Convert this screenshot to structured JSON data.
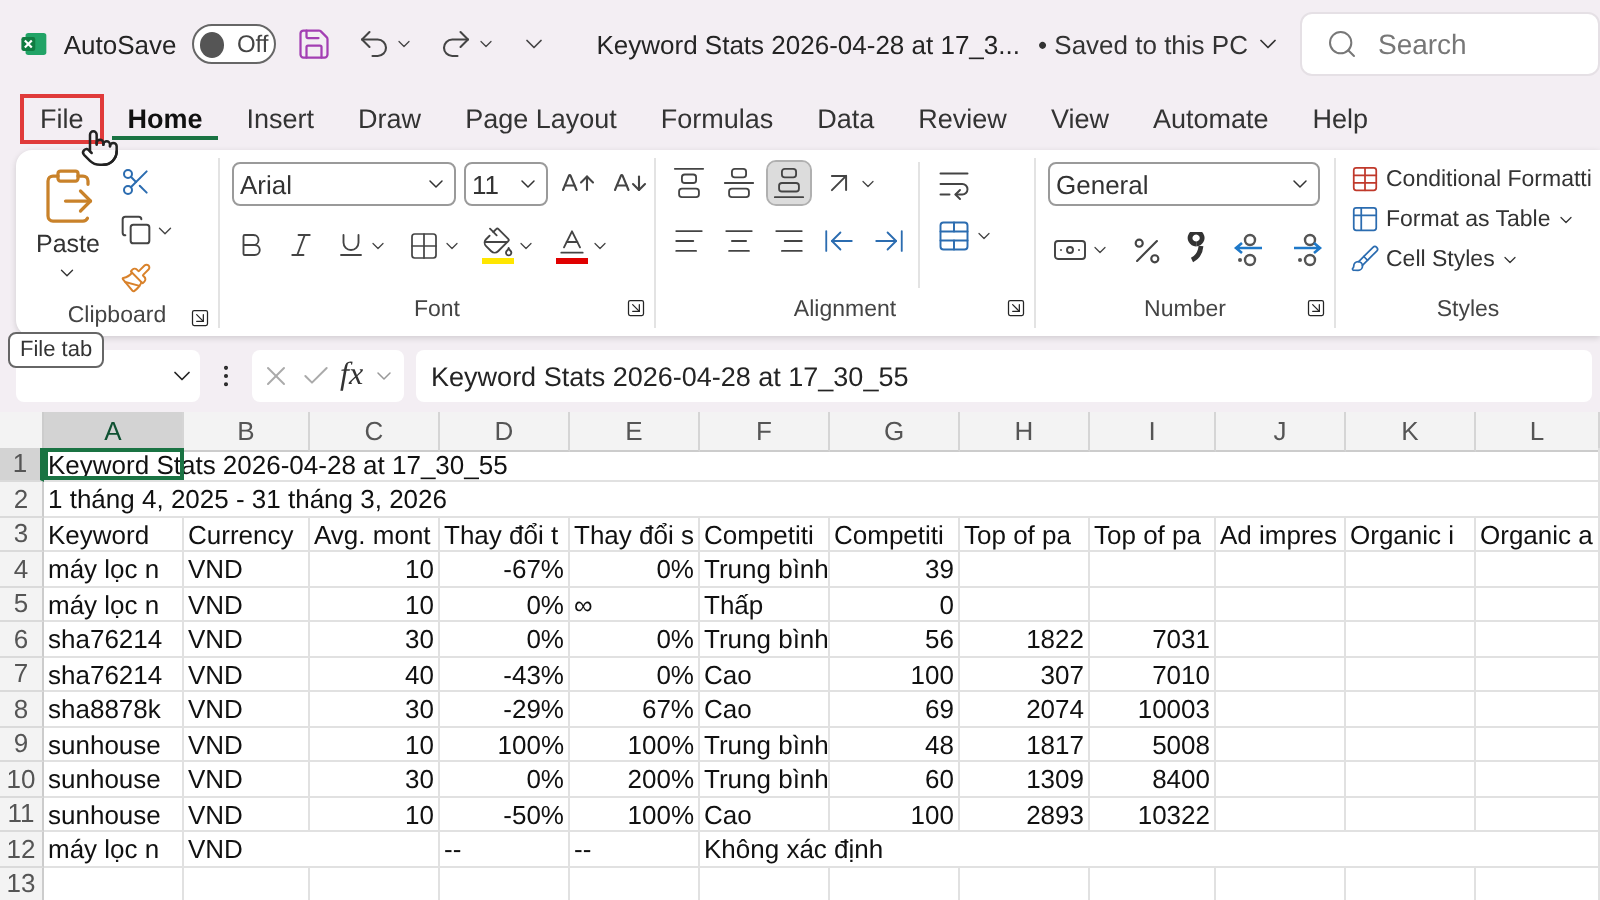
{
  "title_bar": {
    "autosave_label": "AutoSave",
    "autosave": {
      "on": false,
      "label": "Off"
    },
    "title": "Keyword Stats 2026-04-28 at 17_3...",
    "save_status": "• Saved to this PC",
    "search": {
      "placeholder": "Search"
    }
  },
  "tabs": [
    {
      "label": "File",
      "selected": false,
      "highlighted": true
    },
    {
      "label": "Home",
      "selected": true,
      "highlighted": false
    },
    {
      "label": "Insert",
      "selected": false,
      "highlighted": false
    },
    {
      "label": "Draw",
      "selected": false,
      "highlighted": false
    },
    {
      "label": "Page Layout",
      "selected": false,
      "highlighted": false
    },
    {
      "label": "Formulas",
      "selected": false,
      "highlighted": false
    },
    {
      "label": "Data",
      "selected": false,
      "highlighted": false
    },
    {
      "label": "Review",
      "selected": false,
      "highlighted": false
    },
    {
      "label": "View",
      "selected": false,
      "highlighted": false
    },
    {
      "label": "Automate",
      "selected": false,
      "highlighted": false
    },
    {
      "label": "Help",
      "selected": false,
      "highlighted": false
    }
  ],
  "ribbon": {
    "clipboard": {
      "label": "Clipboard",
      "paste": "Paste"
    },
    "font": {
      "label": "Font",
      "font_name": "Arial",
      "font_size": "11"
    },
    "alignment": {
      "label": "Alignment",
      "vertical_buttons": [
        {
          "kind": "top",
          "selected": false
        },
        {
          "kind": "middle",
          "selected": false
        },
        {
          "kind": "bottom",
          "selected": true
        }
      ]
    },
    "number": {
      "label": "Number",
      "format": "General"
    },
    "styles": {
      "label": "Styles",
      "buttons": [
        "Conditional Formatti",
        "Format as Table",
        "Cell Styles"
      ]
    }
  },
  "tooltip": "File tab",
  "formula_bar": {
    "fx": "fx",
    "formula": "Keyword Stats 2026-04-28 at 17_30_55"
  },
  "sheet": {
    "columns": [
      {
        "label": "A",
        "selected": true
      },
      {
        "label": "B",
        "selected": false
      },
      {
        "label": "C",
        "selected": false
      },
      {
        "label": "D",
        "selected": false
      },
      {
        "label": "E",
        "selected": false
      },
      {
        "label": "F",
        "selected": false
      },
      {
        "label": "G",
        "selected": false
      },
      {
        "label": "H",
        "selected": false
      },
      {
        "label": "I",
        "selected": false
      },
      {
        "label": "J",
        "selected": false
      },
      {
        "label": "K",
        "selected": false
      },
      {
        "label": "L",
        "selected": false
      }
    ],
    "rows": [
      {
        "number": "1",
        "selected": true,
        "cells": [
          {
            "text": "Keyword Stats 2026-04-28 at 17_30_55",
            "kind": "text",
            "selected": true
          },
          null,
          null,
          null,
          null,
          null,
          null,
          null,
          null,
          null,
          null,
          null
        ]
      },
      {
        "number": "2",
        "selected": false,
        "cells": [
          {
            "text": "1 tháng 4, 2025 - 31 tháng 3, 2026",
            "kind": "text",
            "selected": false
          },
          null,
          null,
          null,
          null,
          null,
          null,
          null,
          null,
          null,
          null,
          null
        ]
      },
      {
        "number": "3",
        "selected": false,
        "cells": [
          {
            "text": "Keyword",
            "kind": "text",
            "selected": false
          },
          {
            "text": "Currency",
            "kind": "text",
            "selected": false
          },
          {
            "text": "Avg. mont",
            "kind": "text",
            "selected": false
          },
          {
            "text": "Thay đổi t",
            "kind": "text",
            "selected": false
          },
          {
            "text": "Thay đổi s",
            "kind": "text",
            "selected": false
          },
          {
            "text": "Competiti",
            "kind": "text",
            "selected": false
          },
          {
            "text": "Competiti",
            "kind": "text",
            "selected": false
          },
          {
            "text": "Top of pa",
            "kind": "text",
            "selected": false
          },
          {
            "text": "Top of pa",
            "kind": "text",
            "selected": false
          },
          {
            "text": "Ad impres",
            "kind": "text",
            "selected": false
          },
          {
            "text": "Organic i",
            "kind": "text",
            "selected": false
          },
          {
            "text": "Organic a",
            "kind": "text",
            "selected": false
          }
        ]
      },
      {
        "number": "4",
        "selected": false,
        "cells": [
          {
            "text": "máy lọc n",
            "kind": "text",
            "selected": false
          },
          {
            "text": "VND",
            "kind": "text",
            "selected": false
          },
          {
            "text": "10",
            "kind": "number",
            "selected": false
          },
          {
            "text": "-67%",
            "kind": "number",
            "selected": false
          },
          {
            "text": "0%",
            "kind": "number",
            "selected": false
          },
          {
            "text": "Trung bình",
            "kind": "text",
            "selected": false
          },
          {
            "text": "39",
            "kind": "number",
            "selected": false
          },
          null,
          null,
          null,
          null,
          null
        ]
      },
      {
        "number": "5",
        "selected": false,
        "cells": [
          {
            "text": "máy lọc n",
            "kind": "text",
            "selected": false
          },
          {
            "text": "VND",
            "kind": "text",
            "selected": false
          },
          {
            "text": "10",
            "kind": "number",
            "selected": false
          },
          {
            "text": "0%",
            "kind": "number",
            "selected": false
          },
          {
            "text": "∞",
            "kind": "text",
            "selected": false
          },
          {
            "text": "Thấp",
            "kind": "text",
            "selected": false
          },
          {
            "text": "0",
            "kind": "number",
            "selected": false
          },
          null,
          null,
          null,
          null,
          null
        ]
      },
      {
        "number": "6",
        "selected": false,
        "cells": [
          {
            "text": "sha76214",
            "kind": "text",
            "selected": false
          },
          {
            "text": "VND",
            "kind": "text",
            "selected": false
          },
          {
            "text": "30",
            "kind": "number",
            "selected": false
          },
          {
            "text": "0%",
            "kind": "number",
            "selected": false
          },
          {
            "text": "0%",
            "kind": "number",
            "selected": false
          },
          {
            "text": "Trung bình",
            "kind": "text",
            "selected": false
          },
          {
            "text": "56",
            "kind": "number",
            "selected": false
          },
          {
            "text": "1822",
            "kind": "number",
            "selected": false
          },
          {
            "text": "7031",
            "kind": "number",
            "selected": false
          },
          null,
          null,
          null
        ]
      },
      {
        "number": "7",
        "selected": false,
        "cells": [
          {
            "text": "sha76214",
            "kind": "text",
            "selected": false
          },
          {
            "text": "VND",
            "kind": "text",
            "selected": false
          },
          {
            "text": "40",
            "kind": "number",
            "selected": false
          },
          {
            "text": "-43%",
            "kind": "number",
            "selected": false
          },
          {
            "text": "0%",
            "kind": "number",
            "selected": false
          },
          {
            "text": "Cao",
            "kind": "text",
            "selected": false
          },
          {
            "text": "100",
            "kind": "number",
            "selected": false
          },
          {
            "text": "307",
            "kind": "number",
            "selected": false
          },
          {
            "text": "7010",
            "kind": "number",
            "selected": false
          },
          null,
          null,
          null
        ]
      },
      {
        "number": "8",
        "selected": false,
        "cells": [
          {
            "text": "sha8878k",
            "kind": "text",
            "selected": false
          },
          {
            "text": "VND",
            "kind": "text",
            "selected": false
          },
          {
            "text": "30",
            "kind": "number",
            "selected": false
          },
          {
            "text": "-29%",
            "kind": "number",
            "selected": false
          },
          {
            "text": "67%",
            "kind": "number",
            "selected": false
          },
          {
            "text": "Cao",
            "kind": "text",
            "selected": false
          },
          {
            "text": "69",
            "kind": "number",
            "selected": false
          },
          {
            "text": "2074",
            "kind": "number",
            "selected": false
          },
          {
            "text": "10003",
            "kind": "number",
            "selected": false
          },
          null,
          null,
          null
        ]
      },
      {
        "number": "9",
        "selected": false,
        "cells": [
          {
            "text": "sunhouse",
            "kind": "text",
            "selected": false
          },
          {
            "text": "VND",
            "kind": "text",
            "selected": false
          },
          {
            "text": "10",
            "kind": "number",
            "selected": false
          },
          {
            "text": "100%",
            "kind": "number",
            "selected": false
          },
          {
            "text": "100%",
            "kind": "number",
            "selected": false
          },
          {
            "text": "Trung bình",
            "kind": "text",
            "selected": false
          },
          {
            "text": "48",
            "kind": "number",
            "selected": false
          },
          {
            "text": "1817",
            "kind": "number",
            "selected": false
          },
          {
            "text": "5008",
            "kind": "number",
            "selected": false
          },
          null,
          null,
          null
        ]
      },
      {
        "number": "10",
        "selected": false,
        "cells": [
          {
            "text": "sunhouse",
            "kind": "text",
            "selected": false
          },
          {
            "text": "VND",
            "kind": "text",
            "selected": false
          },
          {
            "text": "30",
            "kind": "number",
            "selected": false
          },
          {
            "text": "0%",
            "kind": "number",
            "selected": false
          },
          {
            "text": "200%",
            "kind": "number",
            "selected": false
          },
          {
            "text": "Trung bình",
            "kind": "text",
            "selected": false
          },
          {
            "text": "60",
            "kind": "number",
            "selected": false
          },
          {
            "text": "1309",
            "kind": "number",
            "selected": false
          },
          {
            "text": "8400",
            "kind": "number",
            "selected": false
          },
          null,
          null,
          null
        ]
      },
      {
        "number": "11",
        "selected": false,
        "cells": [
          {
            "text": "sunhouse",
            "kind": "text",
            "selected": false
          },
          {
            "text": "VND",
            "kind": "text",
            "selected": false
          },
          {
            "text": "10",
            "kind": "number",
            "selected": false
          },
          {
            "text": "-50%",
            "kind": "number",
            "selected": false
          },
          {
            "text": "100%",
            "kind": "number",
            "selected": false
          },
          {
            "text": "Cao",
            "kind": "text",
            "selected": false
          },
          {
            "text": "100",
            "kind": "number",
            "selected": false
          },
          {
            "text": "2893",
            "kind": "number",
            "selected": false
          },
          {
            "text": "10322",
            "kind": "number",
            "selected": false
          },
          null,
          null,
          null
        ]
      },
      {
        "number": "12",
        "selected": false,
        "cells": [
          {
            "text": "máy lọc n",
            "kind": "text",
            "selected": false
          },
          {
            "text": "VND",
            "kind": "text",
            "selected": false
          },
          null,
          {
            "text": "--",
            "kind": "text",
            "selected": false
          },
          {
            "text": "--",
            "kind": "text",
            "selected": false
          },
          {
            "text": "Không xác định",
            "kind": "text",
            "selected": false
          },
          null,
          null,
          null,
          null,
          null,
          null
        ]
      },
      {
        "number": "13",
        "selected": false,
        "cells": [
          null,
          null,
          null,
          null,
          null,
          null,
          null,
          null,
          null,
          null,
          null,
          null
        ]
      }
    ]
  }
}
